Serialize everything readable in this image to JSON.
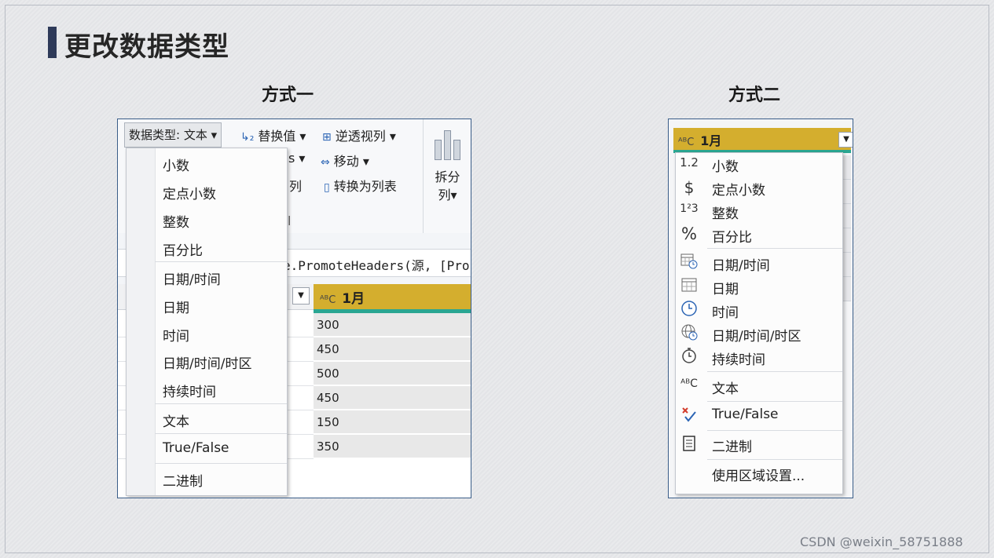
{
  "title": "更改数据类型",
  "method1": {
    "label": "方式一",
    "ribbon": {
      "data_type_button": "数据类型: 文本 ▾",
      "replace_values": "替换值 ▾",
      "unpivot": "逆透视列 ▾",
      "move": "移动 ▾",
      "convert_to_list": "转换为列表",
      "partial_1": "s ▾",
      "partial_2": "列",
      "partial_3": "l",
      "split_col_line1": "拆分",
      "split_col_line2": "列▾"
    },
    "formula_fragment": "e.PromoteHeaders(源, [Pro",
    "column_header": "1月",
    "cells": [
      "300",
      "450",
      "500",
      "450",
      "150",
      "350"
    ],
    "menu": {
      "group1": [
        "小数",
        "定点小数",
        "整数",
        "百分比"
      ],
      "group2": [
        "日期/时间",
        "日期",
        "时间",
        "日期/时间/时区",
        "持续时间"
      ],
      "group3": [
        "文本"
      ],
      "group4": [
        "True/False"
      ],
      "group5": [
        "二进制"
      ]
    }
  },
  "method2": {
    "label": "方式二",
    "column_header": "1月",
    "menu": [
      {
        "icon": "1.2",
        "label": "小数"
      },
      {
        "icon": "$",
        "label": "定点小数"
      },
      {
        "icon": "1²3",
        "label": "整数"
      },
      {
        "icon": "%",
        "label": "百分比"
      },
      {
        "icon": "calendar-clock",
        "label": "日期/时间"
      },
      {
        "icon": "calendar",
        "label": "日期"
      },
      {
        "icon": "clock",
        "label": "时间"
      },
      {
        "icon": "globe-clock",
        "label": "日期/时间/时区"
      },
      {
        "icon": "stopwatch",
        "label": "持续时间"
      },
      {
        "icon": "ABC",
        "label": "文本"
      },
      {
        "icon": "true-false",
        "label": "True/False"
      },
      {
        "icon": "binary",
        "label": "二进制"
      },
      {
        "icon": "",
        "label": "使用区域设置..."
      }
    ]
  },
  "watermark": "CSDN @weixin_58751888",
  "colors": {
    "accent": "#2e3a59",
    "column_header": "#d4ae2e",
    "column_underline": "#2aa692",
    "panel_border": "#3a5d88"
  }
}
